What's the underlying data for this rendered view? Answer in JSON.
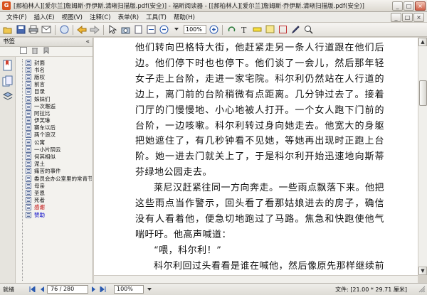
{
  "window": {
    "title": "[郝柏林人][爱尔兰]詹姆斯·乔伊斯.清晰扫描版.pdf(安全)] - 福昕阅读器 - [[郝柏林人][爱尔兰]詹姆斯·乔伊斯.清晰扫描版.pdf(安全)]",
    "logo_char": "G",
    "minimize": "_",
    "maximize": "□",
    "close": "×"
  },
  "menu": {
    "items": [
      "文件(F)",
      "插入(E)",
      "视图(V)",
      "注释(C)",
      "表单(R)",
      "工具(T)",
      "帮助(H)"
    ]
  },
  "toolbar": {
    "zoom_value": "100%",
    "icons": [
      "open-icon",
      "save-icon",
      "print-icon",
      "email-icon",
      "hand-icon",
      "back-icon",
      "forward-icon",
      "select-icon",
      "snapshot-icon",
      "fit-page-icon",
      "fit-width-icon",
      "zoom-out-icon",
      "zoom-in-icon",
      "rotate-icon",
      "typewriter-icon",
      "highlight-icon",
      "note-icon",
      "shape-icon",
      "pen-icon",
      "find-icon"
    ]
  },
  "sidebar": {
    "title": "书签",
    "collapse_glyph": "«",
    "bookmarks": [
      {
        "label": "封面",
        "style": "normal"
      },
      {
        "label": "书名",
        "style": "normal"
      },
      {
        "label": "版权",
        "style": "normal"
      },
      {
        "label": "前言",
        "style": "normal"
      },
      {
        "label": "目录",
        "style": "normal"
      },
      {
        "label": "姊妹们",
        "style": "normal"
      },
      {
        "label": "一次邂逅",
        "style": "normal"
      },
      {
        "label": "阿拉比",
        "style": "normal"
      },
      {
        "label": "伊芙琳",
        "style": "normal"
      },
      {
        "label": "赛车以后",
        "style": "normal"
      },
      {
        "label": "两个浪汉",
        "style": "normal"
      },
      {
        "label": "公寓",
        "style": "normal"
      },
      {
        "label": "一小片阴云",
        "style": "normal"
      },
      {
        "label": "何其相似",
        "style": "normal"
      },
      {
        "label": "泥土",
        "style": "normal"
      },
      {
        "label": "痛苦的事件",
        "style": "normal"
      },
      {
        "label": "委员会办公室里的常青节",
        "style": "normal"
      },
      {
        "label": "母亲",
        "style": "normal"
      },
      {
        "label": "圣恩",
        "style": "normal"
      },
      {
        "label": "死者",
        "style": "normal"
      },
      {
        "label": "感谢",
        "style": "red"
      },
      {
        "label": "赞助",
        "style": "blue"
      }
    ]
  },
  "document": {
    "paragraphs": [
      "他们转向巴格特大街，他赶紧走另一条人行道跟在他们后边。他们停下时也也停下。他们谈了一会儿，然后那年轻女子走上台阶，走进一家宅院。科尔利仍然站在人行道的边上，离门前的台阶稍微有点距离。几分钟过去了。接着门厅的门慢慢地、小心地被人打开。一个女人跑下门前的台阶，一边咳嗽。科尔利转过身向她走去。他宽大的身躯把她遮住了，有几秒钟看不见她，等她再出现时正跑上台阶。她一进去门就关上了，于是科尔利开始迅速地向斯蒂芬绿地公园走去。",
      "莱尼汉赶紧往同一方向奔走。一些雨点飘落下来。他把这些雨点当作警示，回头看了看那姑娘进去的房子，确信没有人看着他，便急切地跑过了马路。焦急和快跑使他气喘吁吁。他高声喊道：",
      "“喂，科尔利！”",
      "科尔利回过头看看是谁在喊他，然后像原先那样继续前"
    ]
  },
  "statusbar": {
    "ready": "就绪",
    "page": "76 / 280",
    "zoom": "100%",
    "size": "文件: [21.00 * 29.71 厘米]"
  }
}
